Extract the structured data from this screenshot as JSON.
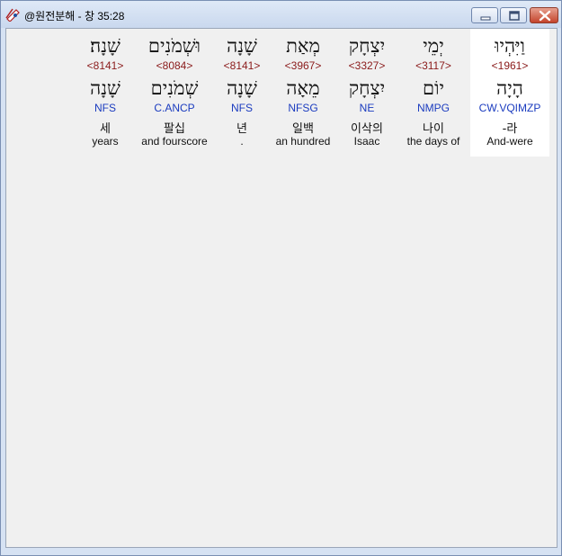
{
  "window": {
    "title": "@원전분해 - 창 35:28"
  },
  "words": [
    {
      "hebrew": "וַיִּהְיוּ",
      "strong": "<1961>",
      "lemma": "הָיָה",
      "morph": "CW.VQIMZP",
      "korean": "-라",
      "english": "And-were",
      "selected": true
    },
    {
      "hebrew": "יְמֵי",
      "strong": "<3117>",
      "lemma": "יוֹם",
      "morph": "NMPG",
      "korean": "나이",
      "english": "the days of",
      "selected": false
    },
    {
      "hebrew": "יִצְחָק",
      "strong": "<3327>",
      "lemma": "יִצְחָק",
      "morph": "NE",
      "korean": "이삭의",
      "english": "Isaac",
      "selected": false
    },
    {
      "hebrew": "מְאַת",
      "strong": "<3967>",
      "lemma": "מֵאָה",
      "morph": "NFSG",
      "korean": "일백",
      "english": "an hundred",
      "selected": false
    },
    {
      "hebrew": "שָׁנָה",
      "strong": "<8141>",
      "lemma": "שָׁנָה",
      "morph": "NFS",
      "korean": "년",
      "english": ".",
      "selected": false
    },
    {
      "hebrew": "וּשְׁמֹנִים",
      "strong": "<8084>",
      "lemma": "שְׁמֹנִים",
      "morph": "C.ANCP",
      "korean": "팔십",
      "english": "and fourscore",
      "selected": false
    },
    {
      "hebrew": "שָׁנָה׃",
      "strong": "<8141>",
      "lemma": "שָׁנָה",
      "morph": "NFS",
      "korean": "세",
      "english": "years",
      "selected": false
    }
  ]
}
